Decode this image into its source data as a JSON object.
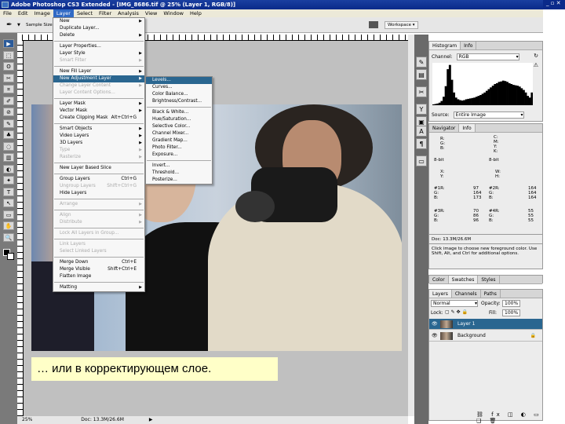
{
  "window": {
    "title": "Adobe Photoshop CS3 Extended - [IMG_8686.tif @ 25% (Layer 1, RGB/8)]"
  },
  "menubar": [
    "File",
    "Edit",
    "Image",
    "Layer",
    "Select",
    "Filter",
    "Analysis",
    "View",
    "Window",
    "Help"
  ],
  "active_menu": "Layer",
  "options": {
    "sample_size": "Sample Size:",
    "workspace": "Workspace"
  },
  "layer_menu": [
    {
      "label": "New",
      "arrow": true
    },
    {
      "label": "Duplicate Layer..."
    },
    {
      "label": "Delete",
      "arrow": true
    },
    {
      "sep": true
    },
    {
      "label": "Layer Properties..."
    },
    {
      "label": "Layer Style",
      "arrow": true
    },
    {
      "label": "Smart Filter",
      "arrow": true,
      "disabled": true
    },
    {
      "sep": true
    },
    {
      "label": "New Fill Layer",
      "arrow": true
    },
    {
      "label": "New Adjustment Layer",
      "arrow": true,
      "highlighted": true
    },
    {
      "label": "Change Layer Content",
      "arrow": true,
      "disabled": true
    },
    {
      "label": "Layer Content Options...",
      "disabled": true
    },
    {
      "sep": true
    },
    {
      "label": "Layer Mask",
      "arrow": true
    },
    {
      "label": "Vector Mask",
      "arrow": true
    },
    {
      "label": "Create Clipping Mask",
      "shortcut": "Alt+Ctrl+G"
    },
    {
      "sep": true
    },
    {
      "label": "Smart Objects",
      "arrow": true
    },
    {
      "label": "Video Layers",
      "arrow": true
    },
    {
      "label": "3D Layers",
      "arrow": true
    },
    {
      "label": "Type",
      "arrow": true,
      "disabled": true
    },
    {
      "label": "Rasterize",
      "arrow": true,
      "disabled": true
    },
    {
      "sep": true
    },
    {
      "label": "New Layer Based Slice"
    },
    {
      "sep": true
    },
    {
      "label": "Group Layers",
      "shortcut": "Ctrl+G"
    },
    {
      "label": "Ungroup Layers",
      "shortcut": "Shift+Ctrl+G",
      "disabled": true
    },
    {
      "label": "Hide Layers"
    },
    {
      "sep": true
    },
    {
      "label": "Arrange",
      "arrow": true,
      "disabled": true
    },
    {
      "sep": true
    },
    {
      "label": "Align",
      "arrow": true,
      "disabled": true
    },
    {
      "label": "Distribute",
      "arrow": true,
      "disabled": true
    },
    {
      "sep": true
    },
    {
      "label": "Lock All Layers in Group...",
      "disabled": true
    },
    {
      "sep": true
    },
    {
      "label": "Link Layers",
      "disabled": true
    },
    {
      "label": "Select Linked Layers",
      "disabled": true
    },
    {
      "sep": true
    },
    {
      "label": "Merge Down",
      "shortcut": "Ctrl+E"
    },
    {
      "label": "Merge Visible",
      "shortcut": "Shift+Ctrl+E"
    },
    {
      "label": "Flatten Image"
    },
    {
      "sep": true
    },
    {
      "label": "Matting",
      "arrow": true
    }
  ],
  "adjustment_submenu": [
    {
      "label": "Levels...",
      "highlighted": true
    },
    {
      "label": "Curves..."
    },
    {
      "label": "Color Balance..."
    },
    {
      "label": "Brightness/Contrast..."
    },
    {
      "sep": true
    },
    {
      "label": "Black & White..."
    },
    {
      "label": "Hue/Saturation..."
    },
    {
      "label": "Selective Color..."
    },
    {
      "label": "Channel Mixer..."
    },
    {
      "label": "Gradient Map..."
    },
    {
      "label": "Photo Filter..."
    },
    {
      "label": "Exposure..."
    },
    {
      "sep": true
    },
    {
      "label": "Invert..."
    },
    {
      "label": "Threshold..."
    },
    {
      "label": "Posterize..."
    }
  ],
  "histogram": {
    "tabs": [
      "Histogram",
      "Info"
    ],
    "channel_label": "Channel:",
    "channel": "RGB",
    "source_label": "Source:",
    "source": "Entire Image",
    "levels": [
      2,
      3,
      4,
      6,
      10,
      20,
      45,
      85,
      95,
      60,
      30,
      18,
      14,
      12,
      11,
      12,
      14,
      15,
      16,
      17,
      18,
      20,
      22,
      24,
      27,
      30,
      34,
      38,
      42,
      46,
      50,
      52,
      55,
      56,
      58,
      57,
      55,
      52,
      50,
      48,
      47,
      46,
      44,
      40,
      36,
      30,
      22,
      18,
      30
    ]
  },
  "info": {
    "tabs": [
      "Navigator",
      "Info"
    ],
    "rgb": [
      "R:",
      "G:",
      "B:"
    ],
    "cmyk": [
      "C:",
      "M:",
      "Y:",
      "K:"
    ],
    "bit_left": "8-bit",
    "bit_right": "8-bit",
    "xy": [
      "X:",
      "Y:"
    ],
    "wh": [
      "W:",
      "H:"
    ],
    "s1": {
      "labels": [
        "#1R:",
        "G:",
        "B:"
      ],
      "values": [
        "97",
        "164",
        "173"
      ]
    },
    "s2": {
      "labels": [
        "#2R:",
        "G:",
        "B:"
      ],
      "values": [
        "164",
        "164",
        "164"
      ]
    },
    "s3": {
      "labels": [
        "#3R:",
        "G:",
        "B:"
      ],
      "values": [
        "70",
        "86",
        "96"
      ]
    },
    "s4": {
      "labels": [
        "#4R:",
        "G:",
        "B:"
      ],
      "values": [
        "55",
        "55",
        "55"
      ]
    },
    "doc": "Doc: 13.3M/26.6M",
    "hint": "Click image to choose new foreground color. Use Shift, Alt, and Ctrl for additional options."
  },
  "color_tabs": [
    "Color",
    "Swatches",
    "Styles"
  ],
  "layers": {
    "tabs": [
      "Layers",
      "Channels",
      "Paths"
    ],
    "blend": "Normal",
    "opacity_label": "Opacity:",
    "opacity": "100%",
    "lock_label": "Lock:",
    "fill_label": "Fill:",
    "fill": "100%",
    "items": [
      {
        "name": "Layer 1",
        "selected": true
      },
      {
        "name": "Background",
        "locked": true
      }
    ]
  },
  "status": {
    "zoom": "25%",
    "doc": "Doc: 13.3M/26.6M"
  },
  "caption": "… или в корректирующем слое."
}
